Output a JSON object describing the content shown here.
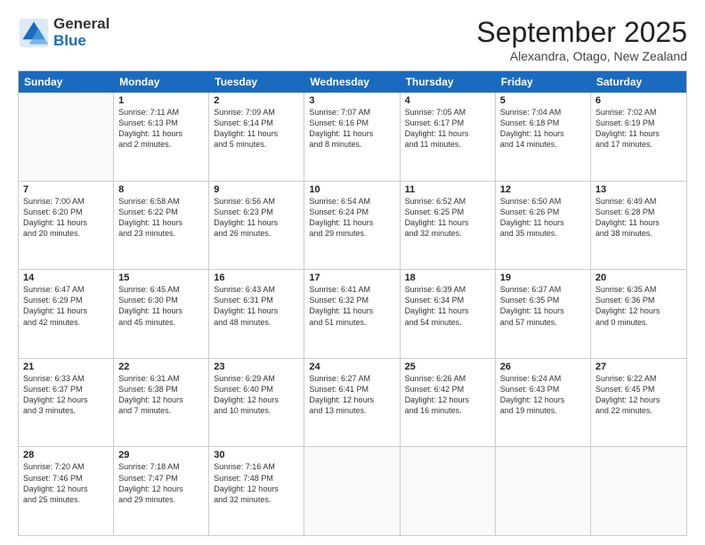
{
  "logo": {
    "general": "General",
    "blue": "Blue"
  },
  "title": "September 2025",
  "location": "Alexandra, Otago, New Zealand",
  "days": [
    "Sunday",
    "Monday",
    "Tuesday",
    "Wednesday",
    "Thursday",
    "Friday",
    "Saturday"
  ],
  "weeks": [
    [
      {
        "day": "",
        "lines": []
      },
      {
        "day": "1",
        "lines": [
          "Sunrise: 7:11 AM",
          "Sunset: 6:13 PM",
          "Daylight: 11 hours",
          "and 2 minutes."
        ]
      },
      {
        "day": "2",
        "lines": [
          "Sunrise: 7:09 AM",
          "Sunset: 6:14 PM",
          "Daylight: 11 hours",
          "and 5 minutes."
        ]
      },
      {
        "day": "3",
        "lines": [
          "Sunrise: 7:07 AM",
          "Sunset: 6:16 PM",
          "Daylight: 11 hours",
          "and 8 minutes."
        ]
      },
      {
        "day": "4",
        "lines": [
          "Sunrise: 7:05 AM",
          "Sunset: 6:17 PM",
          "Daylight: 11 hours",
          "and 11 minutes."
        ]
      },
      {
        "day": "5",
        "lines": [
          "Sunrise: 7:04 AM",
          "Sunset: 6:18 PM",
          "Daylight: 11 hours",
          "and 14 minutes."
        ]
      },
      {
        "day": "6",
        "lines": [
          "Sunrise: 7:02 AM",
          "Sunset: 6:19 PM",
          "Daylight: 11 hours",
          "and 17 minutes."
        ]
      }
    ],
    [
      {
        "day": "7",
        "lines": [
          "Sunrise: 7:00 AM",
          "Sunset: 6:20 PM",
          "Daylight: 11 hours",
          "and 20 minutes."
        ]
      },
      {
        "day": "8",
        "lines": [
          "Sunrise: 6:58 AM",
          "Sunset: 6:22 PM",
          "Daylight: 11 hours",
          "and 23 minutes."
        ]
      },
      {
        "day": "9",
        "lines": [
          "Sunrise: 6:56 AM",
          "Sunset: 6:23 PM",
          "Daylight: 11 hours",
          "and 26 minutes."
        ]
      },
      {
        "day": "10",
        "lines": [
          "Sunrise: 6:54 AM",
          "Sunset: 6:24 PM",
          "Daylight: 11 hours",
          "and 29 minutes."
        ]
      },
      {
        "day": "11",
        "lines": [
          "Sunrise: 6:52 AM",
          "Sunset: 6:25 PM",
          "Daylight: 11 hours",
          "and 32 minutes."
        ]
      },
      {
        "day": "12",
        "lines": [
          "Sunrise: 6:50 AM",
          "Sunset: 6:26 PM",
          "Daylight: 11 hours",
          "and 35 minutes."
        ]
      },
      {
        "day": "13",
        "lines": [
          "Sunrise: 6:49 AM",
          "Sunset: 6:28 PM",
          "Daylight: 11 hours",
          "and 38 minutes."
        ]
      }
    ],
    [
      {
        "day": "14",
        "lines": [
          "Sunrise: 6:47 AM",
          "Sunset: 6:29 PM",
          "Daylight: 11 hours",
          "and 42 minutes."
        ]
      },
      {
        "day": "15",
        "lines": [
          "Sunrise: 6:45 AM",
          "Sunset: 6:30 PM",
          "Daylight: 11 hours",
          "and 45 minutes."
        ]
      },
      {
        "day": "16",
        "lines": [
          "Sunrise: 6:43 AM",
          "Sunset: 6:31 PM",
          "Daylight: 11 hours",
          "and 48 minutes."
        ]
      },
      {
        "day": "17",
        "lines": [
          "Sunrise: 6:41 AM",
          "Sunset: 6:32 PM",
          "Daylight: 11 hours",
          "and 51 minutes."
        ]
      },
      {
        "day": "18",
        "lines": [
          "Sunrise: 6:39 AM",
          "Sunset: 6:34 PM",
          "Daylight: 11 hours",
          "and 54 minutes."
        ]
      },
      {
        "day": "19",
        "lines": [
          "Sunrise: 6:37 AM",
          "Sunset: 6:35 PM",
          "Daylight: 11 hours",
          "and 57 minutes."
        ]
      },
      {
        "day": "20",
        "lines": [
          "Sunrise: 6:35 AM",
          "Sunset: 6:36 PM",
          "Daylight: 12 hours",
          "and 0 minutes."
        ]
      }
    ],
    [
      {
        "day": "21",
        "lines": [
          "Sunrise: 6:33 AM",
          "Sunset: 6:37 PM",
          "Daylight: 12 hours",
          "and 3 minutes."
        ]
      },
      {
        "day": "22",
        "lines": [
          "Sunrise: 6:31 AM",
          "Sunset: 6:38 PM",
          "Daylight: 12 hours",
          "and 7 minutes."
        ]
      },
      {
        "day": "23",
        "lines": [
          "Sunrise: 6:29 AM",
          "Sunset: 6:40 PM",
          "Daylight: 12 hours",
          "and 10 minutes."
        ]
      },
      {
        "day": "24",
        "lines": [
          "Sunrise: 6:27 AM",
          "Sunset: 6:41 PM",
          "Daylight: 12 hours",
          "and 13 minutes."
        ]
      },
      {
        "day": "25",
        "lines": [
          "Sunrise: 6:26 AM",
          "Sunset: 6:42 PM",
          "Daylight: 12 hours",
          "and 16 minutes."
        ]
      },
      {
        "day": "26",
        "lines": [
          "Sunrise: 6:24 AM",
          "Sunset: 6:43 PM",
          "Daylight: 12 hours",
          "and 19 minutes."
        ]
      },
      {
        "day": "27",
        "lines": [
          "Sunrise: 6:22 AM",
          "Sunset: 6:45 PM",
          "Daylight: 12 hours",
          "and 22 minutes."
        ]
      }
    ],
    [
      {
        "day": "28",
        "lines": [
          "Sunrise: 7:20 AM",
          "Sunset: 7:46 PM",
          "Daylight: 12 hours",
          "and 25 minutes."
        ]
      },
      {
        "day": "29",
        "lines": [
          "Sunrise: 7:18 AM",
          "Sunset: 7:47 PM",
          "Daylight: 12 hours",
          "and 29 minutes."
        ]
      },
      {
        "day": "30",
        "lines": [
          "Sunrise: 7:16 AM",
          "Sunset: 7:48 PM",
          "Daylight: 12 hours",
          "and 32 minutes."
        ]
      },
      {
        "day": "",
        "lines": []
      },
      {
        "day": "",
        "lines": []
      },
      {
        "day": "",
        "lines": []
      },
      {
        "day": "",
        "lines": []
      }
    ]
  ]
}
